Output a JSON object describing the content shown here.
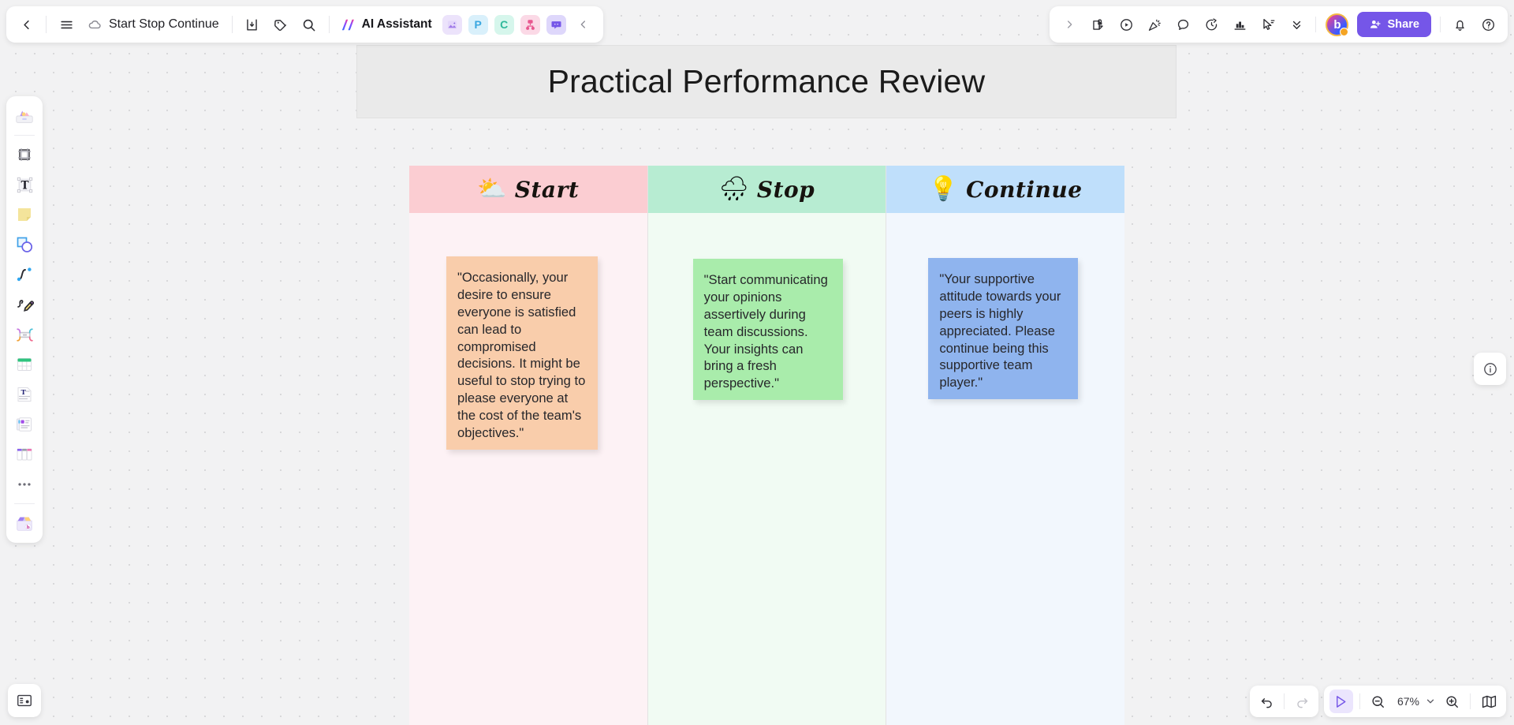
{
  "app": {
    "zoom_level": "67%",
    "accent_color": "#7556e8"
  },
  "topbar": {
    "back_label": "Back",
    "menu_label": "Menu",
    "doc_title": "Start Stop Continue",
    "cloud_status": "saved",
    "export_label": "Export",
    "tag_label": "Tag",
    "search_label": "Search",
    "ai_assistant_label": "AI Assistant",
    "plugins": [
      {
        "name": "ai-image-plugin",
        "glyph": "",
        "bg": "#ece3fb",
        "fg": "#9a78e6"
      },
      {
        "name": "ppt-plugin",
        "glyph": "P",
        "bg": "#d9f0fb",
        "fg": "#3aa7e0"
      },
      {
        "name": "mind-map-plugin",
        "glyph": "C",
        "bg": "#d6f6ec",
        "fg": "#2fb89a"
      },
      {
        "name": "flowchart-plugin",
        "glyph": "",
        "bg": "#fbd9e6",
        "fg": "#e8578f"
      },
      {
        "name": "comment-plugin",
        "glyph": "",
        "bg": "#ded7fb",
        "fg": "#7556e8"
      }
    ],
    "collapse_label": "Collapse"
  },
  "topbar_right": {
    "expand_label": "Expand",
    "tools": [
      "sticky-lock-icon",
      "play-circle-icon",
      "celebrate-icon",
      "comment-bubble-icon",
      "timer-icon",
      "vote-chart-icon",
      "cursor-select-icon",
      "chevrons-down-icon"
    ],
    "avatar_initial": "b",
    "share_label": "Share",
    "notifications_label": "Notifications",
    "help_label": "Help"
  },
  "left_rail": {
    "items": [
      {
        "name": "templates-icon",
        "title": "Templates"
      },
      {
        "name": "frame-icon",
        "title": "Frame"
      },
      {
        "name": "text-icon",
        "title": "Text"
      },
      {
        "name": "sticky-note-icon",
        "title": "Sticky note"
      },
      {
        "name": "shapes-icon",
        "title": "Shapes"
      },
      {
        "name": "curve-pen-icon",
        "title": "Curve"
      },
      {
        "name": "pencil-draw-icon",
        "title": "Draw"
      },
      {
        "name": "connector-icon",
        "title": "Connector"
      },
      {
        "name": "table-icon",
        "title": "Table"
      },
      {
        "name": "text-block-icon",
        "title": "Text block"
      },
      {
        "name": "card-icon",
        "title": "Card"
      },
      {
        "name": "kanban-icon",
        "title": "Kanban"
      },
      {
        "name": "more-tools-icon",
        "title": "More"
      },
      {
        "name": "app-store-icon",
        "title": "Apps"
      }
    ]
  },
  "board": {
    "title": "Practical Performance Review",
    "columns": [
      {
        "key": "start",
        "label": "Start",
        "icon": "sun-behind-cloud-icon",
        "emoji": "⛅",
        "header_bg": "#fbcdd2",
        "body_bg": "#fdf2f5",
        "note": {
          "text": "\"Occasionally, your desire to ensure everyone is satisfied can lead to compromised decisions. It might be useful to stop trying to please everyone at the cost of the team's objectives.\"",
          "bg": "#f9cdab"
        }
      },
      {
        "key": "stop",
        "label": "Stop",
        "icon": "rain-cloud-icon",
        "emoji": "🌧",
        "header_bg": "#b7ecd2",
        "body_bg": "#f1fbf3",
        "note": {
          "text": "\"Start communicating your opinions assertively during team discussions. Your insights can bring a fresh perspective.\"",
          "bg": "#a9ecab"
        }
      },
      {
        "key": "continue",
        "label": "Continue",
        "icon": "light-bulb-icon",
        "emoji": "💡",
        "header_bg": "#bfdffb",
        "body_bg": "#f2f7fd",
        "note": {
          "text": "\"Your supportive attitude towards your peers is highly appreciated. Please continue being this supportive team player.\"",
          "bg": "#8fb4ee"
        }
      }
    ]
  },
  "bottom": {
    "slides_label": "Presentation",
    "info_label": "Info",
    "undo_label": "Undo",
    "redo_label": "Redo",
    "select_label": "Select tool",
    "zoom_out_label": "Zoom out",
    "zoom_in_label": "Zoom in",
    "zoom_value": "67%",
    "minimap_label": "Minimap"
  }
}
